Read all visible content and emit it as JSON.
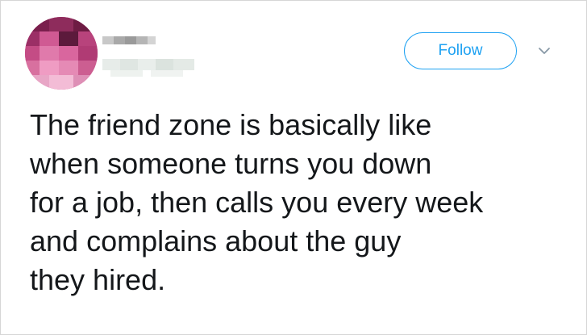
{
  "tweet": {
    "follow_label": "Follow",
    "text_lines": [
      "The friend zone is basically like",
      "when someone turns you down",
      "for a job, then calls you every week",
      "and complains about the guy",
      "they hired."
    ]
  },
  "icons": {
    "menu": "chevron-down-icon",
    "avatar": "avatar"
  },
  "colors": {
    "accent": "#1da1f2",
    "text": "#14171a",
    "caret": "#8899a6",
    "border": "#d6d6d6"
  }
}
